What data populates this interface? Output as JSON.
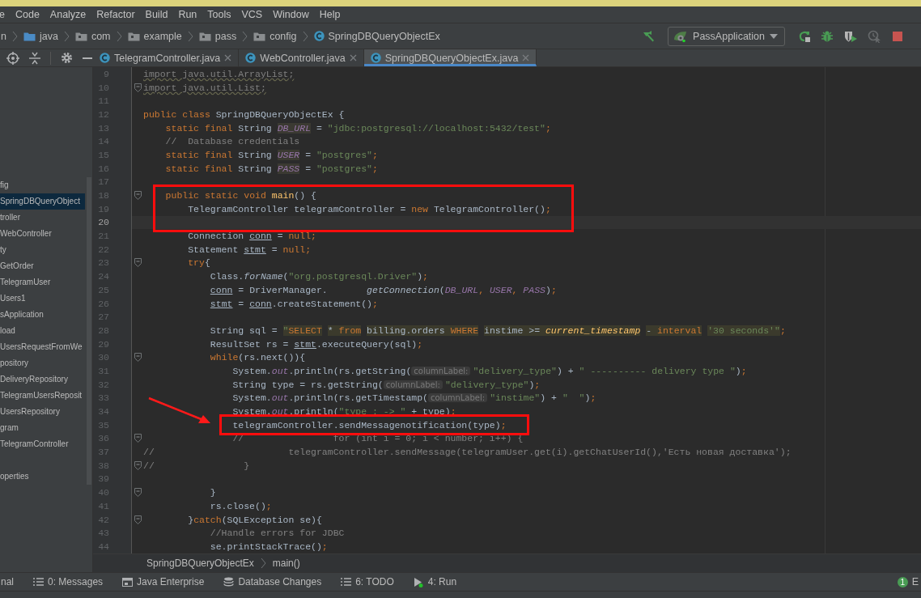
{
  "menu": [
    "e",
    "Code",
    "Analyze",
    "Refactor",
    "Build",
    "Run",
    "Tools",
    "VCS",
    "Window",
    "Help"
  ],
  "navigation_bar": {
    "breadcrumbs": [
      {
        "label": "n",
        "kind": "text"
      },
      {
        "label": "java",
        "kind": "source-folder"
      },
      {
        "label": "com",
        "kind": "package"
      },
      {
        "label": "example",
        "kind": "package"
      },
      {
        "label": "pass",
        "kind": "package"
      },
      {
        "label": "config",
        "kind": "package"
      },
      {
        "label": "SpringDBQueryObjectEx",
        "kind": "class"
      }
    ],
    "run_configuration": "PassApplication",
    "toolbar": [
      {
        "kind": "build",
        "disabled": false
      },
      {
        "kind": "config"
      },
      {
        "kind": "rerun",
        "disabled": false
      },
      {
        "kind": "debug",
        "disabled": false
      },
      {
        "kind": "coverage",
        "disabled": false
      },
      {
        "kind": "profile",
        "disabled": true
      },
      {
        "kind": "stop",
        "disabled": false
      }
    ]
  },
  "project_panel": {
    "sections": [
      {
        "items": [
          {
            "label": "fig",
            "selected": false
          },
          {
            "label": "SpringDBQueryObject",
            "selected": true
          },
          {
            "label": "troller",
            "selected": false
          },
          {
            "label": "WebController",
            "selected": false
          },
          {
            "label": "ty",
            "selected": false
          },
          {
            "label": "GetOrder",
            "selected": false
          },
          {
            "label": "TelegramUser",
            "selected": false
          },
          {
            "label": "Users1",
            "selected": false
          },
          {
            "label": "sApplication",
            "selected": false
          },
          {
            "label": "load",
            "selected": false
          },
          {
            "label": "UsersRequestFromWe",
            "selected": false
          },
          {
            "label": "pository",
            "selected": false
          },
          {
            "label": "DeliveryRepository",
            "selected": false
          },
          {
            "label": "TelegramUsersReposit",
            "selected": false
          },
          {
            "label": "UsersRepository",
            "selected": false
          },
          {
            "label": "gram",
            "selected": false
          },
          {
            "label": "TelegramController",
            "selected": false
          }
        ]
      },
      {
        "items": [
          {
            "label": "operties",
            "selected": false
          }
        ]
      }
    ]
  },
  "editor": {
    "tabs": [
      {
        "label": "TelegramController.java",
        "selected": false
      },
      {
        "label": "WebController.java",
        "selected": false
      },
      {
        "label": "SpringDBQueryObjectEx.java",
        "selected": true
      }
    ],
    "lines": [
      {
        "number": "9",
        "fold": false,
        "current": false,
        "boxed": false,
        "arrow": false,
        "tokens": [
          {
            "text": "import java.util.ArrayList;",
            "kind": "u"
          }
        ]
      },
      {
        "number": "10",
        "fold": true,
        "current": false,
        "boxed": false,
        "arrow": false,
        "tokens": [
          {
            "text": "import java.util.List;",
            "kind": "u"
          }
        ]
      },
      {
        "number": "11",
        "fold": false,
        "current": false,
        "boxed": false,
        "arrow": false
      },
      {
        "number": "12",
        "fold": false,
        "current": false,
        "boxed": false,
        "arrow": false,
        "tokens": [
          {
            "text": "public class ",
            "kind": "kw"
          },
          {
            "text": "SpringDBQueryObjectEx {",
            "kind": "p"
          }
        ]
      },
      {
        "number": "13",
        "fold": false,
        "current": false,
        "boxed": false,
        "arrow": false,
        "tokens": [
          {
            "text": "    static final ",
            "kind": "kw"
          },
          {
            "text": "String ",
            "kind": "p"
          },
          {
            "text": "DB_URL",
            "kind": "fd"
          },
          {
            "text": " = ",
            "kind": "p"
          },
          {
            "text": "\"jdbc:postgresql://localhost:5432/test\"",
            "kind": "s"
          },
          {
            "text": ";",
            "kind": "kw"
          }
        ]
      },
      {
        "number": "14",
        "fold": false,
        "current": false,
        "boxed": false,
        "arrow": false,
        "tokens": [
          {
            "text": "    //  Database credentials",
            "kind": "c"
          }
        ]
      },
      {
        "number": "15",
        "fold": false,
        "current": false,
        "boxed": false,
        "arrow": false,
        "tokens": [
          {
            "text": "    static final ",
            "kind": "kw"
          },
          {
            "text": "String ",
            "kind": "p"
          },
          {
            "text": "USER",
            "kind": "fd"
          },
          {
            "text": " = ",
            "kind": "p"
          },
          {
            "text": "\"postgres\"",
            "kind": "s"
          },
          {
            "text": ";",
            "kind": "kw"
          }
        ]
      },
      {
        "number": "16",
        "fold": false,
        "current": false,
        "boxed": false,
        "arrow": false,
        "tokens": [
          {
            "text": "    static final ",
            "kind": "kw"
          },
          {
            "text": "String ",
            "kind": "p"
          },
          {
            "text": "PASS",
            "kind": "fd"
          },
          {
            "text": " = ",
            "kind": "p"
          },
          {
            "text": "\"postgres\"",
            "kind": "s"
          },
          {
            "text": ";",
            "kind": "kw"
          }
        ]
      },
      {
        "number": "17",
        "fold": false,
        "current": false,
        "boxed": false,
        "arrow": false
      },
      {
        "number": "18",
        "fold": true,
        "current": false,
        "boxed": true,
        "arrow": false,
        "tokens": [
          {
            "text": "    public static void ",
            "kind": "kw"
          },
          {
            "text": "main",
            "kind": "m"
          },
          {
            "text": "() {",
            "kind": "p"
          }
        ]
      },
      {
        "number": "19",
        "fold": false,
        "current": false,
        "boxed": true,
        "arrow": false,
        "tokens": [
          {
            "text": "        TelegramController telegramController = ",
            "kind": "p"
          },
          {
            "text": "new ",
            "kind": "kw"
          },
          {
            "text": "TelegramController()",
            "kind": "p"
          },
          {
            "text": ";",
            "kind": "kw"
          }
        ]
      },
      {
        "number": "20",
        "fold": false,
        "current": true,
        "boxed": true,
        "arrow": false
      },
      {
        "number": "21",
        "fold": false,
        "current": false,
        "boxed": false,
        "arrow": false,
        "tokens": [
          {
            "text": "        Connection ",
            "kind": "p"
          },
          {
            "text": "conn",
            "kind": "v"
          },
          {
            "text": " = ",
            "kind": "p"
          },
          {
            "text": "null;",
            "kind": "kw"
          }
        ]
      },
      {
        "number": "22",
        "fold": false,
        "current": false,
        "boxed": false,
        "arrow": false,
        "tokens": [
          {
            "text": "        Statement ",
            "kind": "p"
          },
          {
            "text": "stmt",
            "kind": "v"
          },
          {
            "text": " = ",
            "kind": "p"
          },
          {
            "text": "null;",
            "kind": "kw"
          }
        ]
      },
      {
        "number": "23",
        "fold": true,
        "current": false,
        "boxed": false,
        "arrow": false,
        "tokens": [
          {
            "text": "        try",
            "kind": "kw"
          },
          {
            "text": "{",
            "kind": "p"
          }
        ]
      },
      {
        "number": "24",
        "fold": false,
        "current": false,
        "boxed": false,
        "arrow": false,
        "tokens": [
          {
            "text": "            Class.",
            "kind": "p"
          },
          {
            "text": "forName",
            "kind": "i"
          },
          {
            "text": "(",
            "kind": "p"
          },
          {
            "text": "\"org.postgresql.Driver\"",
            "kind": "s"
          },
          {
            "text": ")",
            "kind": "p"
          },
          {
            "text": ";",
            "kind": "kw"
          }
        ]
      },
      {
        "number": "25",
        "fold": false,
        "current": false,
        "boxed": false,
        "arrow": false,
        "tokens": [
          {
            "text": "            conn",
            "kind": "v"
          },
          {
            "text": " = DriverManager.       ",
            "kind": "p"
          },
          {
            "text": "getConnection",
            "kind": "i"
          },
          {
            "text": "(",
            "kind": "p"
          },
          {
            "text": "DB_URL",
            "kind": "f"
          },
          {
            "text": ", ",
            "kind": "kw"
          },
          {
            "text": "USER",
            "kind": "f"
          },
          {
            "text": ", ",
            "kind": "kw"
          },
          {
            "text": "PASS",
            "kind": "f"
          },
          {
            "text": ")",
            "kind": "p"
          },
          {
            "text": ";",
            "kind": "kw"
          }
        ]
      },
      {
        "number": "26",
        "fold": false,
        "current": false,
        "boxed": false,
        "arrow": false,
        "tokens": [
          {
            "text": "            stmt",
            "kind": "v"
          },
          {
            "text": " = ",
            "kind": "p"
          },
          {
            "text": "conn",
            "kind": "v"
          },
          {
            "text": ".createStatement()",
            "kind": "p"
          },
          {
            "text": ";",
            "kind": "kw"
          }
        ]
      },
      {
        "number": "27",
        "fold": false,
        "current": false,
        "boxed": false,
        "arrow": false
      },
      {
        "number": "28",
        "fold": false,
        "current": false,
        "boxed": false,
        "arrow": false,
        "tokens": [
          {
            "text": "            String sql = ",
            "kind": "p"
          },
          {
            "text": "\"",
            "kind": "qq"
          },
          {
            "text": "SELECT",
            "kind": "qk"
          },
          {
            "text": " * ",
            "kind": "q"
          },
          {
            "text": "from",
            "kind": "qk"
          },
          {
            "text": " billing.orders ",
            "kind": "q"
          },
          {
            "text": "WHERE",
            "kind": "qk"
          },
          {
            "text": " instime >= ",
            "kind": "q"
          },
          {
            "text": "current_timestamp",
            "kind": "qf"
          },
          {
            "text": " - ",
            "kind": "q"
          },
          {
            "text": "interval",
            "kind": "qk"
          },
          {
            "text": " '30 seconds'",
            "kind": "qs"
          },
          {
            "text": "\"",
            "kind": "qq"
          },
          {
            "text": ";",
            "kind": "kw"
          }
        ]
      },
      {
        "number": "29",
        "fold": false,
        "current": false,
        "boxed": false,
        "arrow": false,
        "tokens": [
          {
            "text": "            ResultSet rs = ",
            "kind": "p"
          },
          {
            "text": "stmt",
            "kind": "v"
          },
          {
            "text": ".executeQuery(sql)",
            "kind": "p"
          },
          {
            "text": ";",
            "kind": "kw"
          }
        ]
      },
      {
        "number": "30",
        "fold": true,
        "current": false,
        "boxed": false,
        "arrow": false,
        "tokens": [
          {
            "text": "            while",
            "kind": "kw"
          },
          {
            "text": "(rs.next()){",
            "kind": "p"
          }
        ]
      },
      {
        "number": "31",
        "fold": false,
        "current": false,
        "boxed": false,
        "arrow": false,
        "tokens": [
          {
            "text": "                System.",
            "kind": "p"
          },
          {
            "text": "out",
            "kind": "f"
          },
          {
            "text": ".println(rs.getString(",
            "kind": "p"
          },
          {
            "text": "columnLabel:",
            "kind": "h"
          },
          {
            "text": "\"delivery_type\"",
            "kind": "s"
          },
          {
            "text": ") + ",
            "kind": "p"
          },
          {
            "text": "\" ---------- delivery type \"",
            "kind": "s"
          },
          {
            "text": ")",
            "kind": "p"
          },
          {
            "text": ";",
            "kind": "kw"
          }
        ]
      },
      {
        "number": "32",
        "fold": false,
        "current": false,
        "boxed": false,
        "arrow": false,
        "tokens": [
          {
            "text": "                String type = rs.getString(",
            "kind": "p"
          },
          {
            "text": "columnLabel:",
            "kind": "h"
          },
          {
            "text": "\"delivery_type\"",
            "kind": "s"
          },
          {
            "text": ")",
            "kind": "p"
          },
          {
            "text": ";",
            "kind": "kw"
          }
        ]
      },
      {
        "number": "33",
        "fold": false,
        "current": false,
        "boxed": false,
        "arrow": false,
        "tokens": [
          {
            "text": "                System.",
            "kind": "p"
          },
          {
            "text": "out",
            "kind": "f"
          },
          {
            "text": ".println(rs.getTimestamp(",
            "kind": "p"
          },
          {
            "text": "columnLabel:",
            "kind": "h"
          },
          {
            "text": "\"instime\"",
            "kind": "s"
          },
          {
            "text": ") + ",
            "kind": "p"
          },
          {
            "text": "\"  \"",
            "kind": "s"
          },
          {
            "text": ")",
            "kind": "p"
          },
          {
            "text": ";",
            "kind": "kw"
          }
        ]
      },
      {
        "number": "34",
        "fold": false,
        "current": false,
        "boxed": false,
        "arrow": false,
        "tokens": [
          {
            "text": "                System.",
            "kind": "p"
          },
          {
            "text": "out",
            "kind": "f"
          },
          {
            "text": ".println(",
            "kind": "p"
          },
          {
            "text": "\"type : -> \"",
            "kind": "s"
          },
          {
            "text": " + type)",
            "kind": "p"
          },
          {
            "text": ";",
            "kind": "kw"
          }
        ]
      },
      {
        "number": "35",
        "fold": false,
        "current": false,
        "boxed": true,
        "arrow": true,
        "tokens": [
          {
            "text": "                telegramController.sendMessagenotification(type)",
            "kind": "p"
          },
          {
            "text": ";",
            "kind": "kw"
          }
        ]
      },
      {
        "number": "36",
        "fold": true,
        "current": false,
        "boxed": false,
        "arrow": false,
        "tokens": [
          {
            "text": "                //                for (int i = 0; i < number; i++) {",
            "kind": "c"
          }
        ]
      },
      {
        "number": "37",
        "fold": false,
        "current": false,
        "boxed": false,
        "arrow": false,
        "tokens": [
          {
            "text": "//                        telegramController.sendMessage(telegramUser.get(i).getChatUserId(),'Есть новая доставка');",
            "kind": "c"
          }
        ]
      },
      {
        "number": "38",
        "fold": true,
        "current": false,
        "boxed": false,
        "arrow": false,
        "tokens": [
          {
            "text": "//                }",
            "kind": "c"
          }
        ]
      },
      {
        "number": "39",
        "fold": false,
        "current": false,
        "boxed": false,
        "arrow": false
      },
      {
        "number": "40",
        "fold": true,
        "current": false,
        "boxed": false,
        "arrow": false,
        "tokens": [
          {
            "text": "            }",
            "kind": "p"
          }
        ]
      },
      {
        "number": "41",
        "fold": false,
        "current": false,
        "boxed": false,
        "arrow": false,
        "tokens": [
          {
            "text": "            rs.close()",
            "kind": "p"
          },
          {
            "text": ";",
            "kind": "kw"
          }
        ]
      },
      {
        "number": "42",
        "fold": true,
        "current": false,
        "boxed": false,
        "arrow": false,
        "tokens": [
          {
            "text": "        }",
            "kind": "p"
          },
          {
            "text": "catch",
            "kind": "kw"
          },
          {
            "text": "(SQLException se){",
            "kind": "p"
          }
        ]
      },
      {
        "number": "43",
        "fold": false,
        "current": false,
        "boxed": false,
        "arrow": false,
        "tokens": [
          {
            "text": "            //Handle errors for JDBC",
            "kind": "c"
          }
        ]
      },
      {
        "number": "44",
        "fold": false,
        "current": false,
        "boxed": false,
        "arrow": false,
        "tokens": [
          {
            "text": "            se.printStackTrace()",
            "kind": "p"
          },
          {
            "text": ";",
            "kind": "kw"
          }
        ]
      }
    ],
    "breadcrumbs": [
      "SpringDBQueryObjectEx",
      "main()"
    ]
  },
  "tool_windows": [
    {
      "label": "nal",
      "kind": "terminal"
    },
    {
      "label": "0: Messages",
      "kind": "messages"
    },
    {
      "label": "Java Enterprise",
      "kind": "java-enterprise"
    },
    {
      "label": "Database Changes",
      "kind": "database"
    },
    {
      "label": "6: TODO",
      "kind": "todo"
    },
    {
      "label": "4: Run",
      "kind": "run"
    }
  ],
  "event_log": {
    "count": "1",
    "label": "E"
  }
}
